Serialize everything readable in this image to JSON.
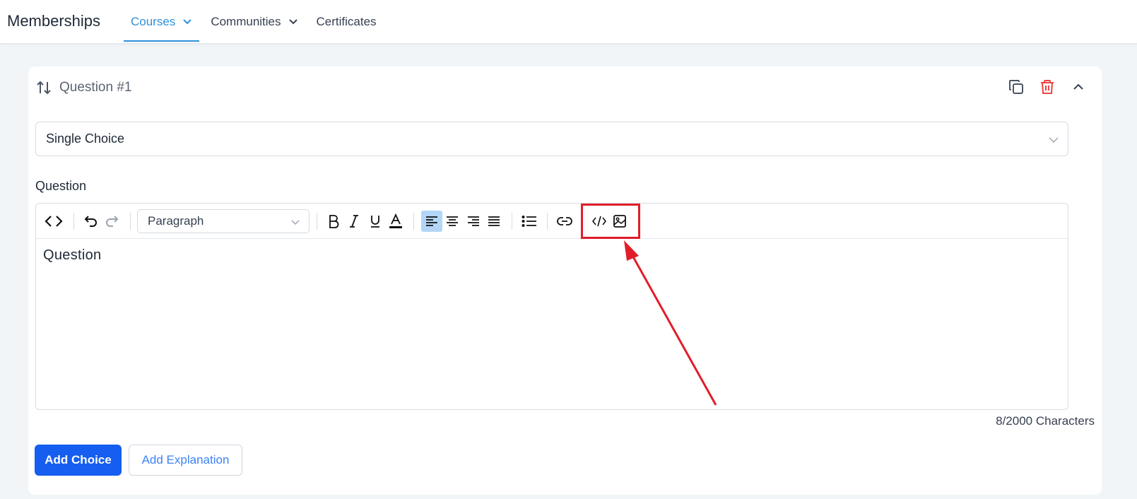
{
  "app": {
    "title": "Memberships"
  },
  "nav": {
    "tabs": [
      {
        "label": "Courses",
        "active": true,
        "has_dropdown": true
      },
      {
        "label": "Communities",
        "active": false,
        "has_dropdown": true
      },
      {
        "label": "Certificates",
        "active": false,
        "has_dropdown": false
      }
    ]
  },
  "question": {
    "title": "Question #1",
    "type_select_value": "Single Choice",
    "label": "Question",
    "editor": {
      "block_format": "Paragraph",
      "content": "Question",
      "char_count": "8/2000 Characters",
      "toolbar_icons": [
        "code-view-icon",
        "undo-icon",
        "redo-icon",
        "bold-icon",
        "italic-icon",
        "underline-icon",
        "text-color-icon",
        "align-left-icon",
        "align-center-icon",
        "align-right-icon",
        "align-justify-icon",
        "bullet-list-icon",
        "link-icon",
        "code-icon",
        "image-icon"
      ]
    },
    "actions": {
      "add_choice": "Add Choice",
      "add_explanation": "Add Explanation"
    }
  },
  "colors": {
    "accent": "#2e90da",
    "primary_button": "#155eef",
    "delete": "#ef4444",
    "annotation": "#e11d2a"
  }
}
